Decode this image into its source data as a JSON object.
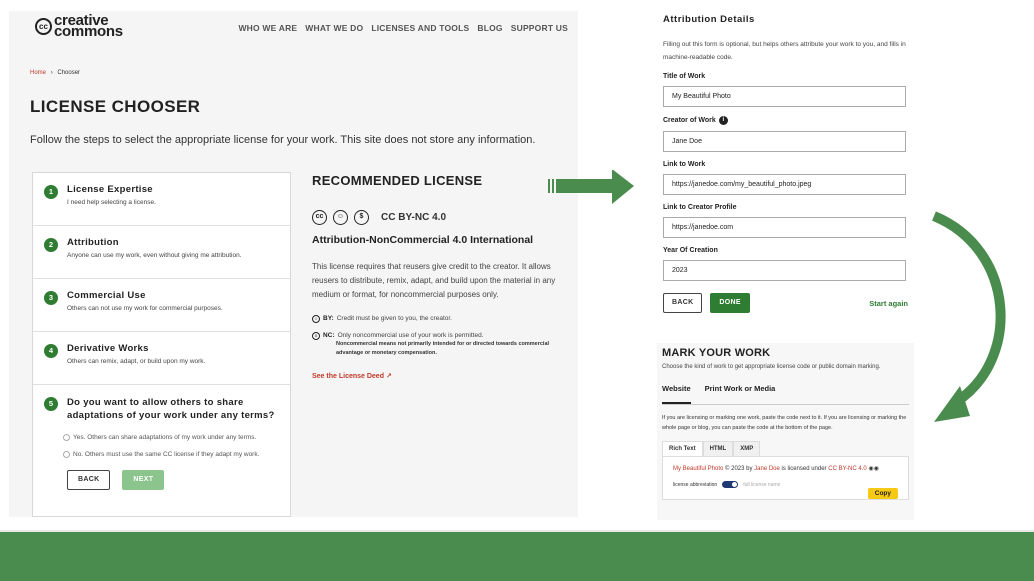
{
  "site": {
    "logo_text": "creative commons",
    "logo_cc": "cc",
    "nav": [
      "WHO WE ARE",
      "WHAT WE DO",
      "LICENSES AND TOOLS",
      "BLOG",
      "SUPPORT US"
    ]
  },
  "breadcrumb": {
    "home": "Home",
    "separator": "›",
    "current": "Chooser"
  },
  "page_title": "LICENSE CHOOSER",
  "intro": "Follow the steps to select the appropriate license for your work. This site does not store any information.",
  "steps": [
    {
      "num": "1",
      "title": "License Expertise",
      "desc": "I need help selecting a license."
    },
    {
      "num": "2",
      "title": "Attribution",
      "desc": "Anyone can use my work, even without giving me attribution."
    },
    {
      "num": "3",
      "title": "Commercial Use",
      "desc": "Others can not use my work for commercial purposes."
    },
    {
      "num": "4",
      "title": "Derivative Works",
      "desc": "Others can remix, adapt, or build upon my work."
    },
    {
      "num": "5",
      "title": "Do you want to allow others to share adaptations of your work under any terms?",
      "options": [
        "Yes. Others can share adaptations of my work under any terms.",
        "No. Others must use the same CC license if they adapt my work."
      ]
    }
  ],
  "step_buttons": {
    "back": "BACK",
    "next": "NEXT"
  },
  "recommended": {
    "heading": "RECOMMENDED LICENSE",
    "code": "CC BY-NC 4.0",
    "icons": [
      "cc-icon",
      "by-icon",
      "nc-icon"
    ],
    "name": "Attribution-NonCommercial 4.0 International",
    "description": "This license requires that reusers give credit to the creator. It allows reusers to distribute, remix, adapt, and build upon the material in any medium or format, for noncommercial purposes only.",
    "by_label": "BY:",
    "by_text": "Credit must be given to you, the creator.",
    "nc_label": "NC:",
    "nc_text": "Only noncommercial use of your work is permitted.",
    "nc_sub": "Noncommercial means not primarily intended for or directed towards commercial advantage or monetary compensation.",
    "deed_link": "See the License Deed"
  },
  "attribution_form": {
    "heading": "Attribution Details",
    "description": "Filling out this form is optional, but helps others attribute your work to you, and fills in machine-readable code.",
    "fields": [
      {
        "label": "Title of Work",
        "value": "My Beautiful Photo"
      },
      {
        "label": "Creator of Work",
        "value": "Jane Doe"
      },
      {
        "label": "Link to Work",
        "value": "https://janedoe.com/my_beautiful_photo.jpeg"
      },
      {
        "label": "Link to Creator Profile",
        "value": "https://janedoe.com"
      },
      {
        "label": "Year Of Creation",
        "value": "2023"
      }
    ],
    "back": "BACK",
    "done": "DONE",
    "start_again": "Start again"
  },
  "mark_work": {
    "heading": "MARK YOUR WORK",
    "description": "Choose the kind of work to get appropriate license code or public domain marking.",
    "tabs": [
      "Website",
      "Print Work or Media"
    ],
    "instructions": "If you are licensing or marking one work, paste the code next to it. If you are licensing or marking the whole page or blog, you can paste the code at the bottom of the page.",
    "code_tabs": [
      "Rich Text",
      "HTML",
      "XMP"
    ],
    "attribution": {
      "title": "My Beautiful Photo",
      "middle1": "© 2023 by",
      "author": "Jane Doe",
      "middle2": "is licensed under",
      "license": "CC BY-NC 4.0"
    },
    "abbr_label": "license abbreviation",
    "full_label": "full license name",
    "copy": "Copy"
  },
  "colors": {
    "brand_green": "#2e7d32",
    "link_red": "#c0392b",
    "band_green": "#4a8c4e",
    "copy_yellow": "#f6c915"
  }
}
